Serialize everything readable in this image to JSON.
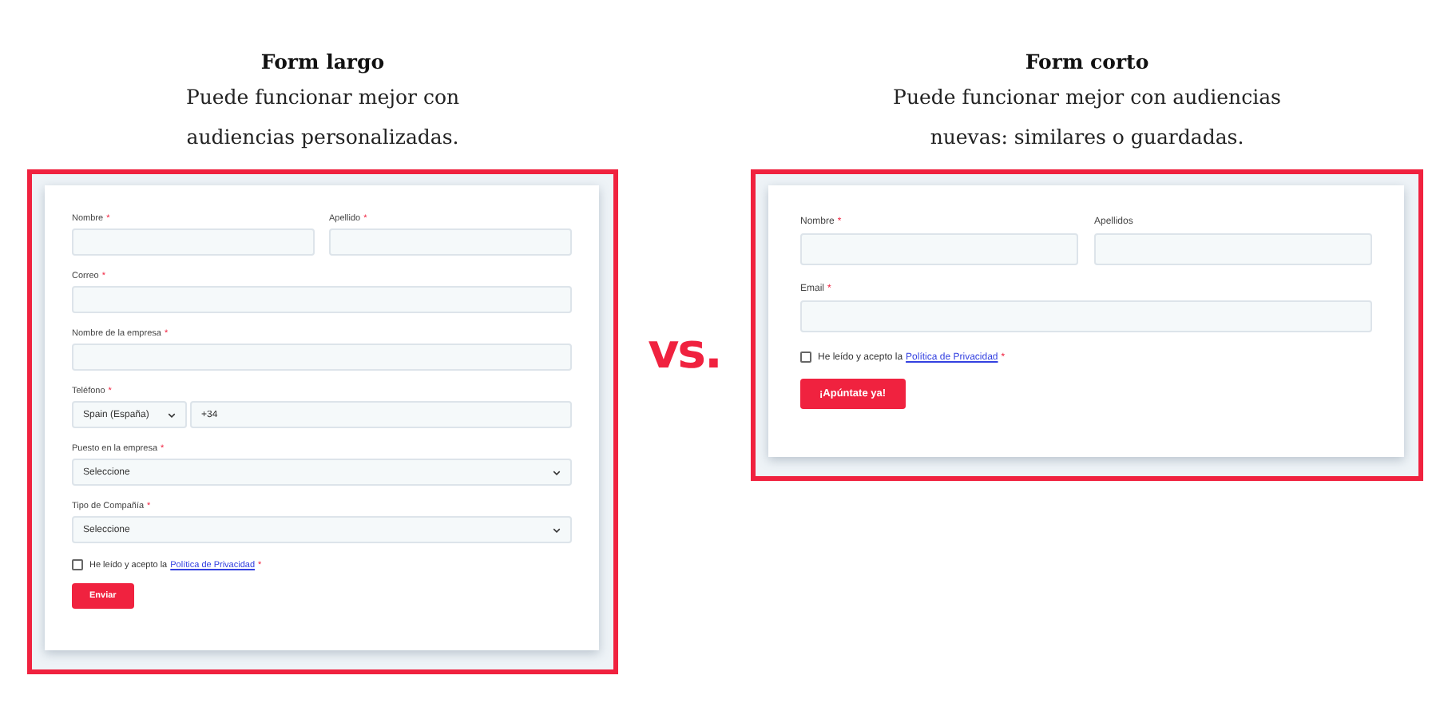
{
  "panels": [
    {
      "title": "Form largo",
      "subtitle": [
        "Puede funcionar mejor con",
        "audiencias personalizadas."
      ],
      "kind": "long",
      "rows": [
        [
          {
            "label": "Nombre",
            "mark": "*",
            "kind": "text"
          },
          {
            "label": "Apellido",
            "mark": "*",
            "kind": "text"
          }
        ],
        [
          {
            "label": "Correo",
            "mark": "*",
            "kind": "text"
          }
        ],
        [
          {
            "label": "Nombre de la empresa",
            "mark": "*",
            "kind": "text"
          }
        ],
        [
          {
            "label": "Teléfono",
            "mark": "*",
            "kind": "phone",
            "country": "Spain (España)",
            "value": "+34"
          }
        ],
        [
          {
            "label": "Puesto en la empresa",
            "mark": "*",
            "kind": "select",
            "value": "Seleccione"
          }
        ],
        [
          {
            "label": "Tipo de Compañía",
            "mark": "*",
            "kind": "select",
            "value": "Seleccione"
          }
        ]
      ],
      "consent": {
        "checked": false,
        "text": "He leído y acepto la",
        "link": "Política de Privacidad",
        "mark": "*"
      },
      "button": "Enviar"
    },
    {
      "title": "Form corto",
      "subtitle": [
        "Puede funcionar mejor con audiencias",
        "nuevas: similares o guardadas."
      ],
      "kind": "short",
      "rows": [
        [
          {
            "label": "Nombre",
            "mark": "*",
            "kind": "text"
          },
          {
            "label": "Apellidos",
            "kind": "text"
          }
        ],
        [
          {
            "label": "Email",
            "mark": "*",
            "kind": "text"
          }
        ]
      ],
      "consent": {
        "checked": false,
        "text": "He leído y acepto la",
        "link": "Política de Privacidad",
        "mark": "*"
      },
      "button": "¡Apúntate ya!"
    }
  ],
  "versus": "vs."
}
